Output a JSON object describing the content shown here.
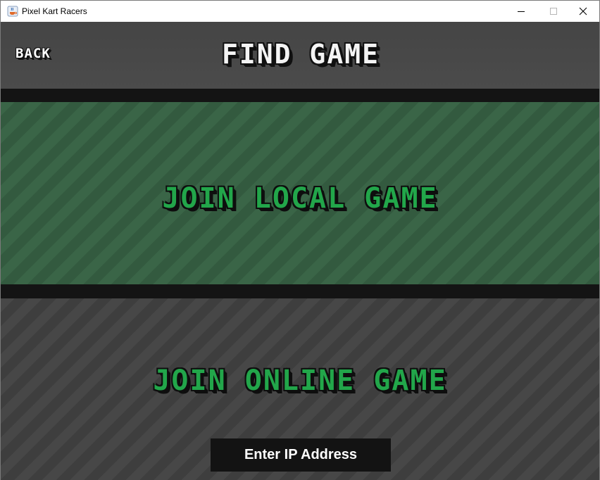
{
  "window": {
    "title": "Pixel Kart Racers",
    "icon": "java-cup-icon"
  },
  "header": {
    "back_label": "BACK",
    "title": "FIND GAME"
  },
  "local": {
    "label": "JOIN LOCAL GAME"
  },
  "online": {
    "label": "JOIN ONLINE GAME",
    "ip_placeholder": "Enter IP Address"
  },
  "colors": {
    "header_bg": "#484848",
    "divider": "#141414",
    "local_stripe_a": "#3a6547",
    "local_stripe_b": "#335a3f",
    "online_stripe_a": "#474747",
    "online_stripe_b": "#3e3e3e",
    "accent_green": "#22a64a",
    "input_bg": "#131313"
  }
}
